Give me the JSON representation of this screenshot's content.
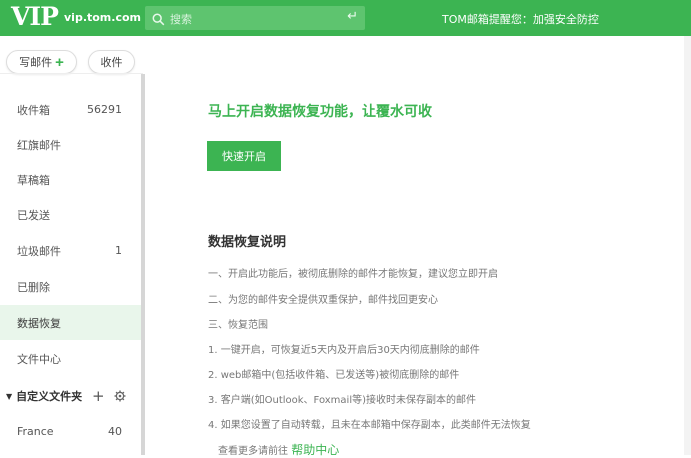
{
  "header": {
    "logo": "VIP",
    "domain": "vip.tom.com",
    "search_placeholder": "搜索",
    "notice": "TOM邮箱提醒您：加强安全防控"
  },
  "toolbar": {
    "compose_label": "写邮件",
    "receive_label": "收件"
  },
  "sidebar": {
    "folders": [
      {
        "label": "收件箱",
        "count": "56291"
      },
      {
        "label": "红旗邮件",
        "count": ""
      },
      {
        "label": "草稿箱",
        "count": ""
      },
      {
        "label": "已发送",
        "count": ""
      },
      {
        "label": "垃圾邮件",
        "count": "1"
      },
      {
        "label": "已删除",
        "count": ""
      },
      {
        "label": "数据恢复",
        "count": "",
        "active": true
      },
      {
        "label": "文件中心",
        "count": ""
      }
    ],
    "custom_folders_label": "自定义文件夹",
    "custom_folders": [
      {
        "label": "France",
        "count": "40"
      }
    ]
  },
  "main": {
    "headline": "马上开启数据恢复功能，让覆水可收",
    "enable_button": "快速开启",
    "section_title": "数据恢复说明",
    "lines": [
      "一、开启此功能后，被彻底删除的邮件才能恢复，建议您立即开启",
      "二、为您的邮件安全提供双重保护，邮件找回更安心",
      "三、恢复范围",
      "1. 一键开启，可恢复近5天内及开启后30天内彻底删除的邮件",
      "2. web邮箱中(包括收件箱、已发送等)被彻底删除的邮件",
      "3. 客户端(如Outlook、Foxmail等)接收时未保存副本的邮件",
      "4. 如果您设置了自动转载，且未在本邮箱中保存副本，此类邮件无法恢复"
    ],
    "more_prefix": "查看更多请前往",
    "help_link": "帮助中心"
  },
  "colors": {
    "brand_green": "#3cb452",
    "active_row": "#e9f6eb"
  }
}
